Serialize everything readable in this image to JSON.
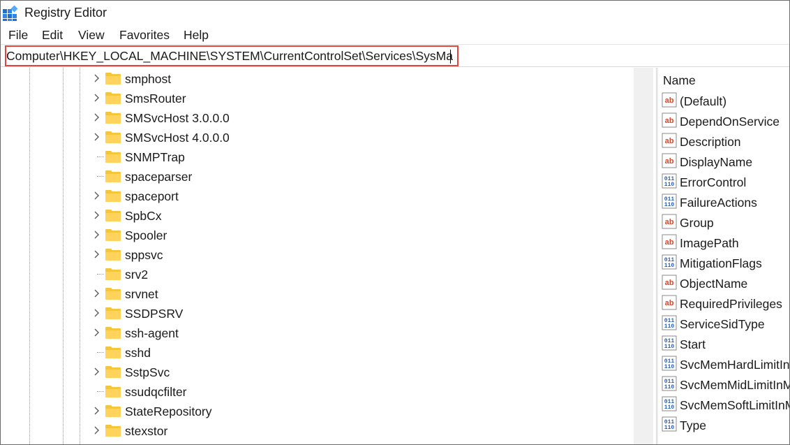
{
  "window": {
    "title": "Registry Editor"
  },
  "menu": [
    "File",
    "Edit",
    "View",
    "Favorites",
    "Help"
  ],
  "address": {
    "path": "Computer\\HKEY_LOCAL_MACHINE\\SYSTEM\\CurrentControlSet\\Services\\SysMain"
  },
  "tree": {
    "items": [
      {
        "label": "smphost",
        "expandable": true
      },
      {
        "label": "SmsRouter",
        "expandable": true
      },
      {
        "label": "SMSvcHost 3.0.0.0",
        "expandable": true
      },
      {
        "label": "SMSvcHost 4.0.0.0",
        "expandable": true
      },
      {
        "label": "SNMPTrap",
        "expandable": false
      },
      {
        "label": "spaceparser",
        "expandable": false
      },
      {
        "label": "spaceport",
        "expandable": true
      },
      {
        "label": "SpbCx",
        "expandable": true
      },
      {
        "label": "Spooler",
        "expandable": true
      },
      {
        "label": "sppsvc",
        "expandable": true
      },
      {
        "label": "srv2",
        "expandable": false
      },
      {
        "label": "srvnet",
        "expandable": true
      },
      {
        "label": "SSDPSRV",
        "expandable": true
      },
      {
        "label": "ssh-agent",
        "expandable": true
      },
      {
        "label": "sshd",
        "expandable": false
      },
      {
        "label": "SstpSvc",
        "expandable": true
      },
      {
        "label": "ssudqcfilter",
        "expandable": false
      },
      {
        "label": "StateRepository",
        "expandable": true
      },
      {
        "label": "stexstor",
        "expandable": true
      }
    ]
  },
  "values": {
    "column_name": "Name",
    "items": [
      {
        "name": "(Default)",
        "icon": "string-value-icon"
      },
      {
        "name": "DependOnService",
        "icon": "string-value-icon"
      },
      {
        "name": "Description",
        "icon": "string-value-icon"
      },
      {
        "name": "DisplayName",
        "icon": "string-value-icon"
      },
      {
        "name": "ErrorControl",
        "icon": "binary-value-icon"
      },
      {
        "name": "FailureActions",
        "icon": "binary-value-icon"
      },
      {
        "name": "Group",
        "icon": "string-value-icon"
      },
      {
        "name": "ImagePath",
        "icon": "string-value-icon"
      },
      {
        "name": "MitigationFlags",
        "icon": "binary-value-icon"
      },
      {
        "name": "ObjectName",
        "icon": "string-value-icon"
      },
      {
        "name": "RequiredPrivileges",
        "icon": "string-value-icon"
      },
      {
        "name": "ServiceSidType",
        "icon": "binary-value-icon"
      },
      {
        "name": "Start",
        "icon": "binary-value-icon"
      },
      {
        "name": "SvcMemHardLimitInMB",
        "icon": "binary-value-icon"
      },
      {
        "name": "SvcMemMidLimitInMB",
        "icon": "binary-value-icon"
      },
      {
        "name": "SvcMemSoftLimitInMB",
        "icon": "binary-value-icon"
      },
      {
        "name": "Type",
        "icon": "binary-value-icon"
      }
    ]
  },
  "colors": {
    "address_highlight": "#e0463e",
    "folder": "#f5c53a",
    "string_icon": "#d9472b",
    "binary_icon": "#2a5fb0"
  }
}
